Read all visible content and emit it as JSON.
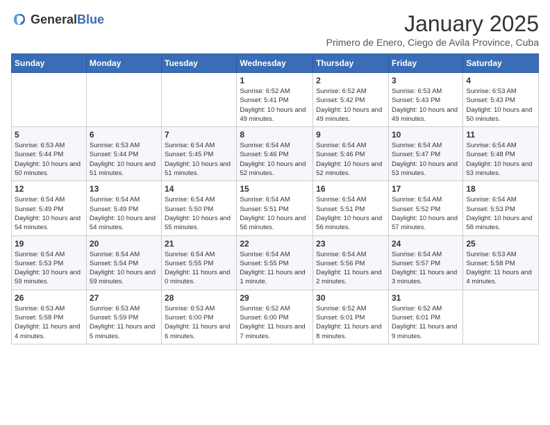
{
  "header": {
    "logo_general": "General",
    "logo_blue": "Blue",
    "month": "January 2025",
    "location": "Primero de Enero, Ciego de Avila Province, Cuba"
  },
  "days_of_week": [
    "Sunday",
    "Monday",
    "Tuesday",
    "Wednesday",
    "Thursday",
    "Friday",
    "Saturday"
  ],
  "weeks": [
    [
      {
        "day": "",
        "info": ""
      },
      {
        "day": "",
        "info": ""
      },
      {
        "day": "",
        "info": ""
      },
      {
        "day": "1",
        "info": "Sunrise: 6:52 AM\nSunset: 5:41 PM\nDaylight: 10 hours and 49 minutes."
      },
      {
        "day": "2",
        "info": "Sunrise: 6:52 AM\nSunset: 5:42 PM\nDaylight: 10 hours and 49 minutes."
      },
      {
        "day": "3",
        "info": "Sunrise: 6:53 AM\nSunset: 5:43 PM\nDaylight: 10 hours and 49 minutes."
      },
      {
        "day": "4",
        "info": "Sunrise: 6:53 AM\nSunset: 5:43 PM\nDaylight: 10 hours and 50 minutes."
      }
    ],
    [
      {
        "day": "5",
        "info": "Sunrise: 6:53 AM\nSunset: 5:44 PM\nDaylight: 10 hours and 50 minutes."
      },
      {
        "day": "6",
        "info": "Sunrise: 6:53 AM\nSunset: 5:44 PM\nDaylight: 10 hours and 51 minutes."
      },
      {
        "day": "7",
        "info": "Sunrise: 6:54 AM\nSunset: 5:45 PM\nDaylight: 10 hours and 51 minutes."
      },
      {
        "day": "8",
        "info": "Sunrise: 6:54 AM\nSunset: 5:46 PM\nDaylight: 10 hours and 52 minutes."
      },
      {
        "day": "9",
        "info": "Sunrise: 6:54 AM\nSunset: 5:46 PM\nDaylight: 10 hours and 52 minutes."
      },
      {
        "day": "10",
        "info": "Sunrise: 6:54 AM\nSunset: 5:47 PM\nDaylight: 10 hours and 53 minutes."
      },
      {
        "day": "11",
        "info": "Sunrise: 6:54 AM\nSunset: 5:48 PM\nDaylight: 10 hours and 53 minutes."
      }
    ],
    [
      {
        "day": "12",
        "info": "Sunrise: 6:54 AM\nSunset: 5:49 PM\nDaylight: 10 hours and 54 minutes."
      },
      {
        "day": "13",
        "info": "Sunrise: 6:54 AM\nSunset: 5:49 PM\nDaylight: 10 hours and 54 minutes."
      },
      {
        "day": "14",
        "info": "Sunrise: 6:54 AM\nSunset: 5:50 PM\nDaylight: 10 hours and 55 minutes."
      },
      {
        "day": "15",
        "info": "Sunrise: 6:54 AM\nSunset: 5:51 PM\nDaylight: 10 hours and 56 minutes."
      },
      {
        "day": "16",
        "info": "Sunrise: 6:54 AM\nSunset: 5:51 PM\nDaylight: 10 hours and 56 minutes."
      },
      {
        "day": "17",
        "info": "Sunrise: 6:54 AM\nSunset: 5:52 PM\nDaylight: 10 hours and 57 minutes."
      },
      {
        "day": "18",
        "info": "Sunrise: 6:54 AM\nSunset: 5:53 PM\nDaylight: 10 hours and 58 minutes."
      }
    ],
    [
      {
        "day": "19",
        "info": "Sunrise: 6:54 AM\nSunset: 5:53 PM\nDaylight: 10 hours and 59 minutes."
      },
      {
        "day": "20",
        "info": "Sunrise: 6:54 AM\nSunset: 5:54 PM\nDaylight: 10 hours and 59 minutes."
      },
      {
        "day": "21",
        "info": "Sunrise: 6:54 AM\nSunset: 5:55 PM\nDaylight: 11 hours and 0 minutes."
      },
      {
        "day": "22",
        "info": "Sunrise: 6:54 AM\nSunset: 5:55 PM\nDaylight: 11 hours and 1 minute."
      },
      {
        "day": "23",
        "info": "Sunrise: 6:54 AM\nSunset: 5:56 PM\nDaylight: 11 hours and 2 minutes."
      },
      {
        "day": "24",
        "info": "Sunrise: 6:54 AM\nSunset: 5:57 PM\nDaylight: 11 hours and 3 minutes."
      },
      {
        "day": "25",
        "info": "Sunrise: 6:53 AM\nSunset: 5:58 PM\nDaylight: 11 hours and 4 minutes."
      }
    ],
    [
      {
        "day": "26",
        "info": "Sunrise: 6:53 AM\nSunset: 5:58 PM\nDaylight: 11 hours and 4 minutes."
      },
      {
        "day": "27",
        "info": "Sunrise: 6:53 AM\nSunset: 5:59 PM\nDaylight: 11 hours and 5 minutes."
      },
      {
        "day": "28",
        "info": "Sunrise: 6:53 AM\nSunset: 6:00 PM\nDaylight: 11 hours and 6 minutes."
      },
      {
        "day": "29",
        "info": "Sunrise: 6:52 AM\nSunset: 6:00 PM\nDaylight: 11 hours and 7 minutes."
      },
      {
        "day": "30",
        "info": "Sunrise: 6:52 AM\nSunset: 6:01 PM\nDaylight: 11 hours and 8 minutes."
      },
      {
        "day": "31",
        "info": "Sunrise: 6:52 AM\nSunset: 6:01 PM\nDaylight: 11 hours and 9 minutes."
      },
      {
        "day": "",
        "info": ""
      }
    ]
  ]
}
